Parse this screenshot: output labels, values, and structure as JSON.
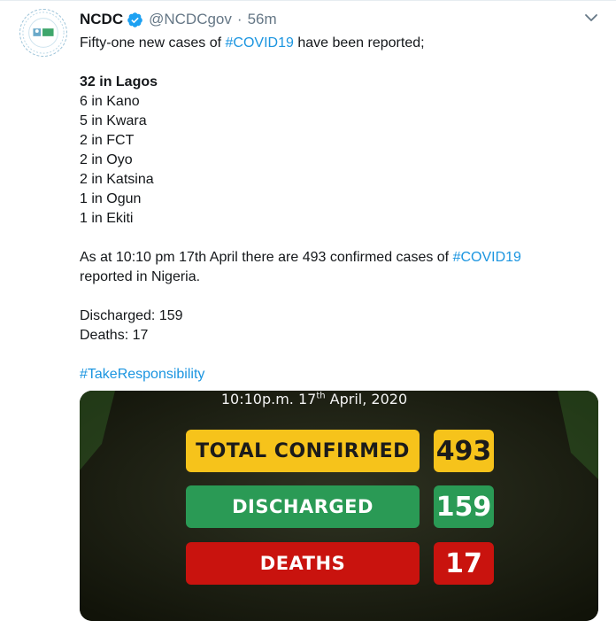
{
  "tweet": {
    "author_name": "NCDC",
    "handle": "@NCDCgov",
    "separator": "·",
    "time": "56m",
    "intro_prefix": "Fifty-one new cases of ",
    "intro_hashtag": "#COVID19",
    "intro_suffix": " have been reported;",
    "state_lines": [
      "32 in Lagos",
      "6 in Kano",
      "5 in Kwara",
      "2 in FCT",
      "2 in Oyo",
      "2 in Katsina",
      "1 in Ogun",
      "1 in Ekiti"
    ],
    "summary_prefix": "As at 10:10 pm 17th April there are 493 confirmed cases of ",
    "summary_hashtag": "#COVID19",
    "summary_suffix": " reported in Nigeria.",
    "discharged_line": "Discharged: 159",
    "deaths_line": "Deaths: 17",
    "closing_hashtag": "#TakeResponsibility"
  },
  "media": {
    "date_text": "10:10p.m. 17",
    "date_sup": "th",
    "date_rest": " April, 2020",
    "stats": [
      {
        "label": "TOTAL CONFIRMED",
        "value": "493",
        "color": "#f6c31b"
      },
      {
        "label": "DISCHARGED",
        "value": "159",
        "color": "#2a9a55"
      },
      {
        "label": "DEATHS",
        "value": "17",
        "color": "#c9130e"
      }
    ]
  },
  "colors": {
    "link": "#1b95e0",
    "verified": "#1da1f2",
    "muted": "#657786"
  },
  "icons": {
    "verified": "verified-badge-icon",
    "caret": "chevron-down-icon"
  }
}
